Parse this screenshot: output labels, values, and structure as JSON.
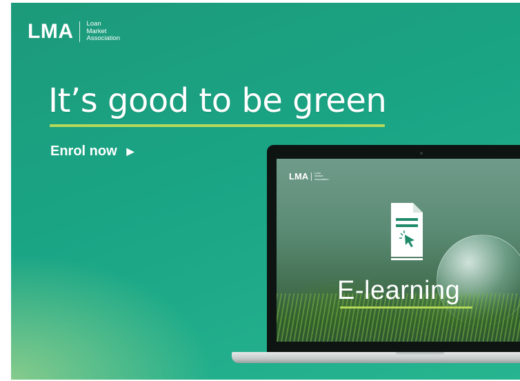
{
  "logo": {
    "mark": "LMA",
    "line1": "Loan",
    "line2": "Market",
    "line3": "Association"
  },
  "headline": "It’s good to be green",
  "cta": {
    "label": "Enrol now",
    "arrow": "▶"
  },
  "screen": {
    "logo": {
      "mark": "LMA",
      "line1": "Loan",
      "line2": "Market",
      "line3": "Association"
    },
    "title": "E-learning",
    "icon": "document-click-icon"
  },
  "colors": {
    "background": "#1ca585",
    "accent": "#b5d95a",
    "text": "#ffffff"
  }
}
